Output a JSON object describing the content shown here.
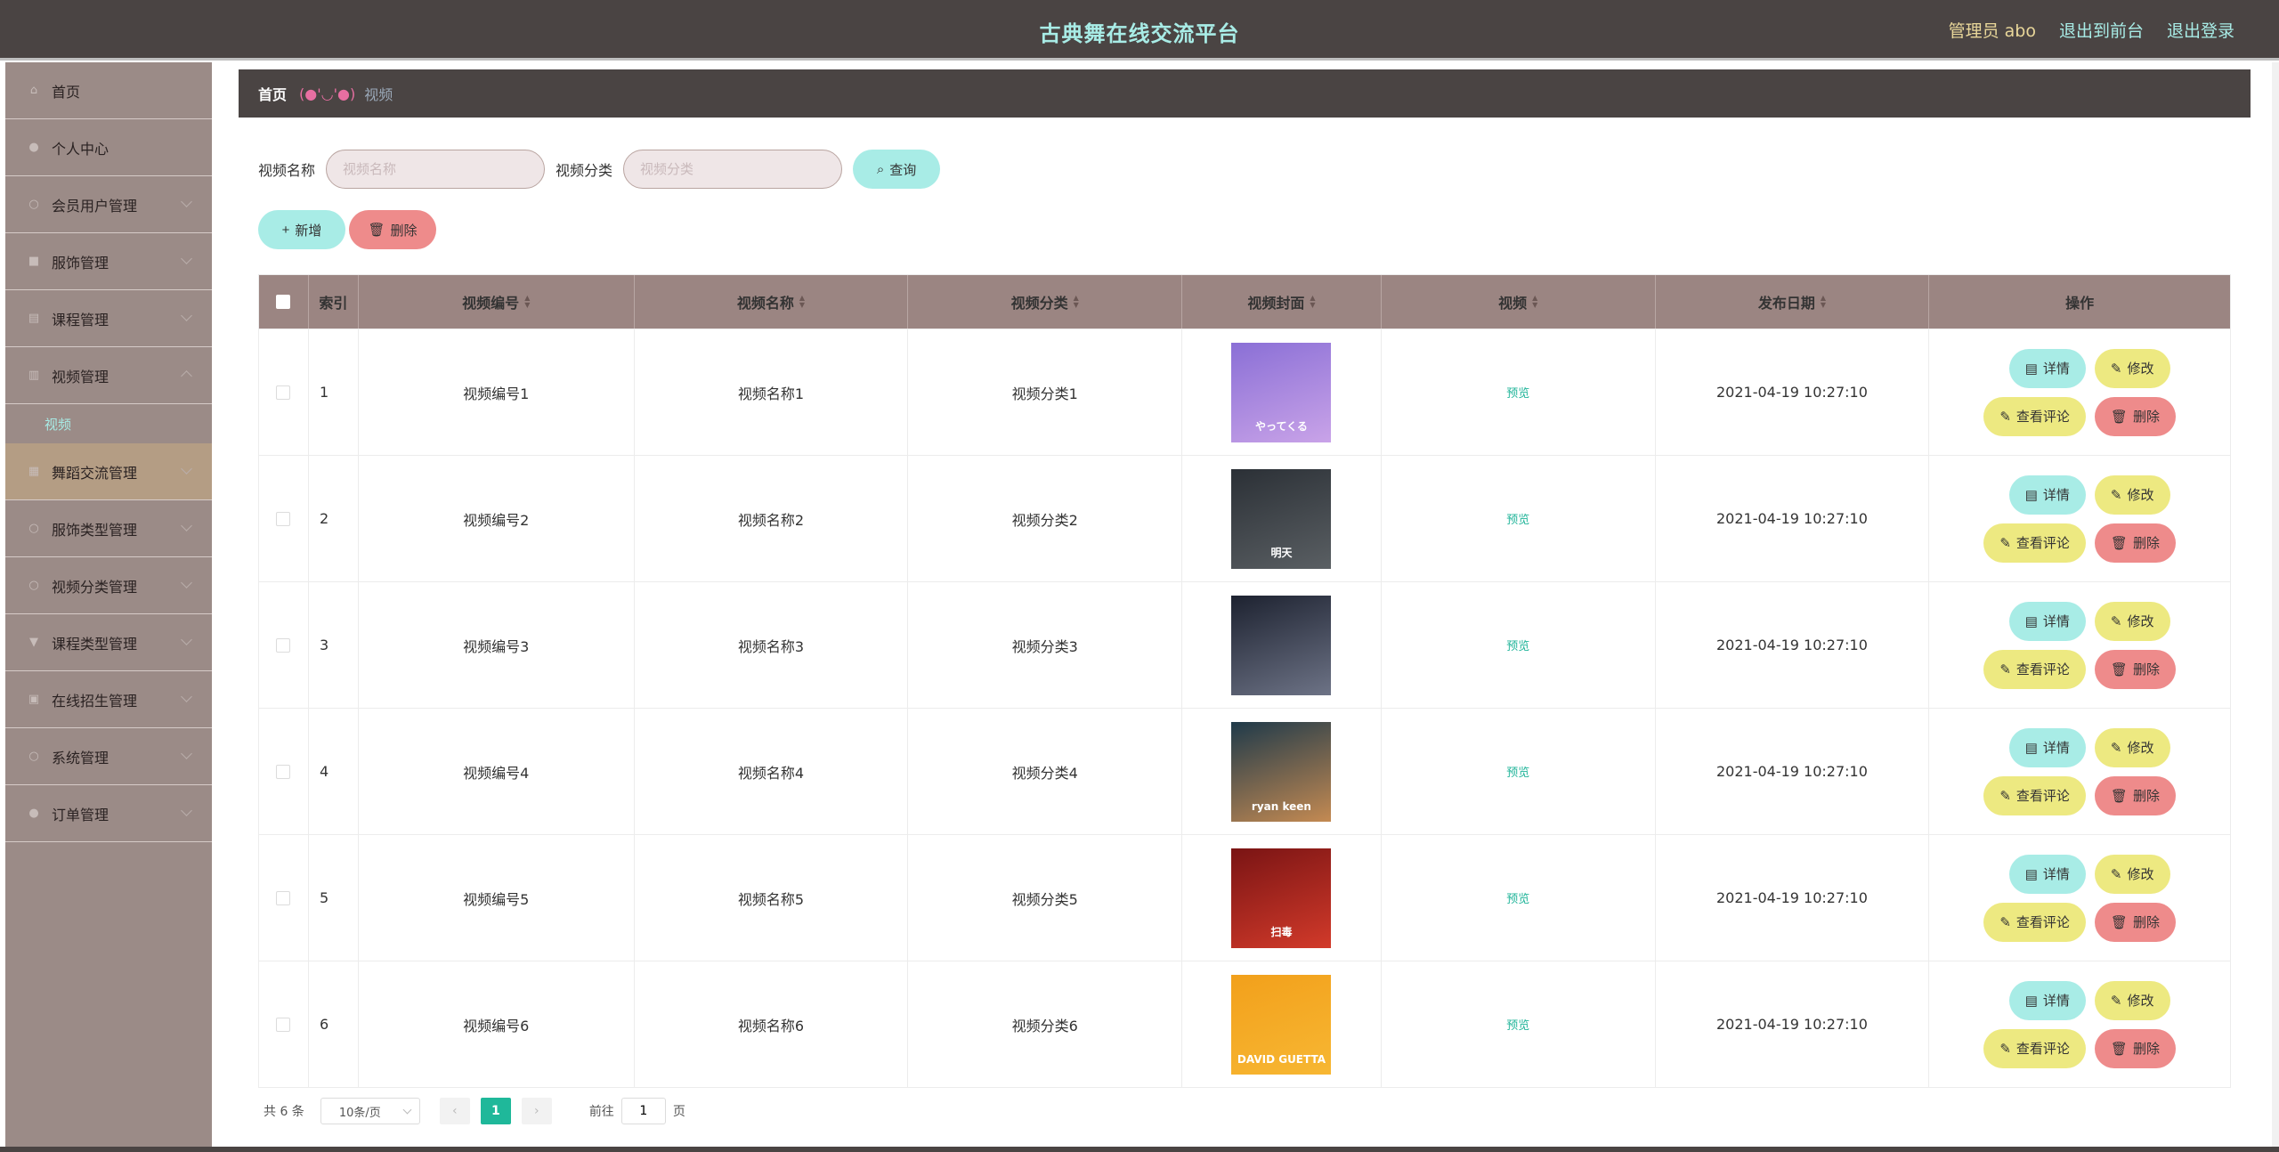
{
  "header": {
    "title": "古典舞在线交流平台",
    "admin": "管理员 abo",
    "to_front": "退出到前台",
    "logout": "退出登录"
  },
  "sidebar": {
    "items": [
      {
        "label": "首页",
        "icon": "home-icon"
      },
      {
        "label": "个人中心",
        "icon": "user-icon"
      },
      {
        "label": "会员用户管理",
        "icon": "users-icon"
      },
      {
        "label": "服饰管理",
        "icon": "shirt-icon"
      },
      {
        "label": "课程管理",
        "icon": "book-icon"
      },
      {
        "label": "视频管理",
        "icon": "video-icon"
      },
      {
        "label": "舞蹈交流管理",
        "icon": "chat-icon"
      },
      {
        "label": "服饰类型管理",
        "icon": "tag-icon"
      },
      {
        "label": "视频分类管理",
        "icon": "folder-icon"
      },
      {
        "label": "课程类型管理",
        "icon": "list-icon"
      },
      {
        "label": "在线招生管理",
        "icon": "lock-icon"
      },
      {
        "label": "系统管理",
        "icon": "gear-icon"
      },
      {
        "label": "订单管理",
        "icon": "order-icon"
      }
    ],
    "submenu_label": "视频"
  },
  "breadcrumb": {
    "home": "首页",
    "face": "(●'◡'●)",
    "current": "视频"
  },
  "search": {
    "name_label": "视频名称",
    "name_placeholder": "视频名称",
    "category_label": "视频分类",
    "category_placeholder": "视频分类",
    "query_button": "查询"
  },
  "actions": {
    "add": "新增",
    "delete": "删除"
  },
  "table": {
    "columns": [
      "索引",
      "视频编号",
      "视频名称",
      "视频分类",
      "视频封面",
      "视频",
      "发布日期",
      "操作"
    ],
    "preview_label": "预览",
    "op_labels": {
      "detail": "详情",
      "edit": "修改",
      "comment": "查看评论",
      "remove": "删除"
    },
    "rows": [
      {
        "index": "1",
        "code": "视频编号1",
        "name": "视频名称1",
        "category": "视频分类1",
        "date": "2021-04-19 10:27:10",
        "cover_colors": [
          "#8a6fd6",
          "#c9a3e8"
        ],
        "cover_text": "やってくる"
      },
      {
        "index": "2",
        "code": "视频编号2",
        "name": "视频名称2",
        "category": "视频分类2",
        "date": "2021-04-19 10:27:10",
        "cover_colors": [
          "#2b3036",
          "#5a5f63"
        ],
        "cover_text": "明天"
      },
      {
        "index": "3",
        "code": "视频编号3",
        "name": "视频名称3",
        "category": "视频分类3",
        "date": "2021-04-19 10:27:10",
        "cover_colors": [
          "#1d2230",
          "#6d7386"
        ],
        "cover_text": ""
      },
      {
        "index": "4",
        "code": "视频编号4",
        "name": "视频名称4",
        "category": "视频分类4",
        "date": "2021-04-19 10:27:10",
        "cover_colors": [
          "#1f3a4a",
          "#c48a52"
        ],
        "cover_text": "ryan keen"
      },
      {
        "index": "5",
        "code": "视频编号5",
        "name": "视频名称5",
        "category": "视频分类5",
        "date": "2021-04-19 10:27:10",
        "cover_colors": [
          "#7a1414",
          "#d23a2a"
        ],
        "cover_text": "扫毒"
      },
      {
        "index": "6",
        "code": "视频编号6",
        "name": "视频名称6",
        "category": "视频分类6",
        "date": "2021-04-19 10:27:10",
        "cover_colors": [
          "#f2a01b",
          "#f7b733"
        ],
        "cover_text": "DAVID GUETTA"
      }
    ]
  },
  "pagination": {
    "total": "共 6 条",
    "page_size": "10条/页",
    "current_page": "1",
    "goto_prefix": "前往",
    "goto_value": "1",
    "goto_suffix": "页"
  }
}
